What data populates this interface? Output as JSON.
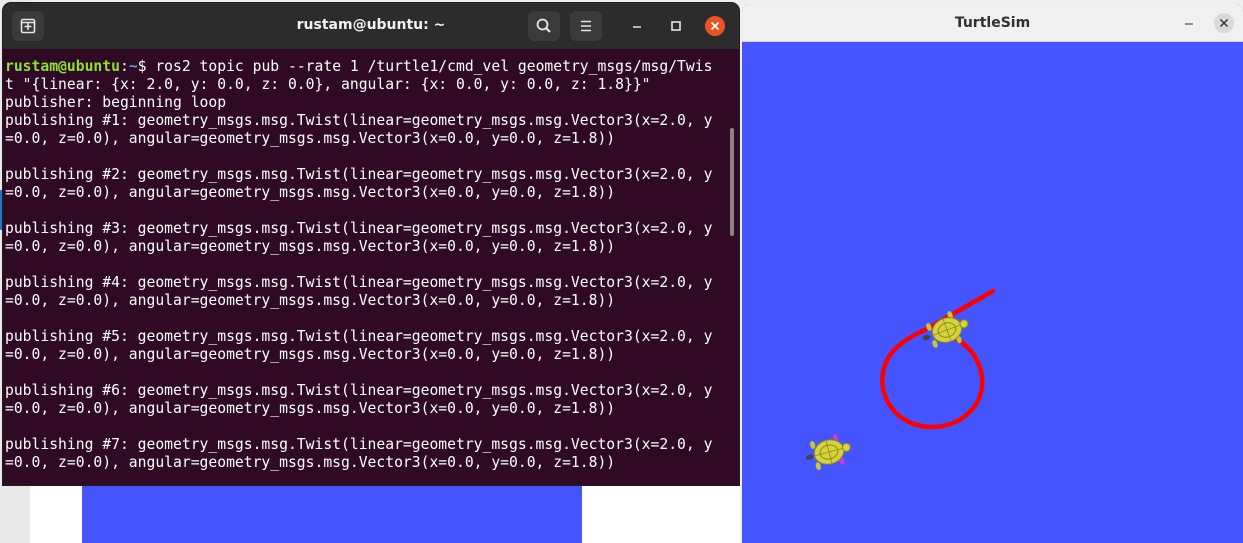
{
  "terminal": {
    "title": "rustam@ubuntu: ~",
    "prompt_user": "rustam@ubuntu",
    "prompt_sep": ":",
    "prompt_path": "~",
    "prompt_symbol": "$ ",
    "lines": [
      "ros2 topic pub --rate 1 /turtle1/cmd_vel geometry_msgs/msg/Twis",
      "t \"{linear: {x: 2.0, y: 0.0, z: 0.0}, angular: {x: 0.0, y: 0.0, z: 1.8}}\"",
      "publisher: beginning loop",
      "publishing #1: geometry_msgs.msg.Twist(linear=geometry_msgs.msg.Vector3(x=2.0, y",
      "=0.0, z=0.0), angular=geometry_msgs.msg.Vector3(x=0.0, y=0.0, z=1.8))",
      "",
      "publishing #2: geometry_msgs.msg.Twist(linear=geometry_msgs.msg.Vector3(x=2.0, y",
      "=0.0, z=0.0), angular=geometry_msgs.msg.Vector3(x=0.0, y=0.0, z=1.8))",
      "",
      "publishing #3: geometry_msgs.msg.Twist(linear=geometry_msgs.msg.Vector3(x=2.0, y",
      "=0.0, z=0.0), angular=geometry_msgs.msg.Vector3(x=0.0, y=0.0, z=1.8))",
      "",
      "publishing #4: geometry_msgs.msg.Twist(linear=geometry_msgs.msg.Vector3(x=2.0, y",
      "=0.0, z=0.0), angular=geometry_msgs.msg.Vector3(x=0.0, y=0.0, z=1.8))",
      "",
      "publishing #5: geometry_msgs.msg.Twist(linear=geometry_msgs.msg.Vector3(x=2.0, y",
      "=0.0, z=0.0), angular=geometry_msgs.msg.Vector3(x=0.0, y=0.0, z=1.8))",
      "",
      "publishing #6: geometry_msgs.msg.Twist(linear=geometry_msgs.msg.Vector3(x=2.0, y",
      "=0.0, z=0.0), angular=geometry_msgs.msg.Vector3(x=0.0, y=0.0, z=1.8))",
      "",
      "publishing #7: geometry_msgs.msg.Twist(linear=geometry_msgs.msg.Vector3(x=2.0, y",
      "=0.0, z=0.0), angular=geometry_msgs.msg.Vector3(x=0.0, y=0.0, z=1.8))"
    ],
    "colors": {
      "background": "#300a24",
      "user": "#8ae234",
      "path": "#729fcf",
      "text": "#ffffff"
    }
  },
  "turtlesim": {
    "title": "TurtleSim",
    "colors": {
      "background": "#4455ff",
      "pen": "#ff0000",
      "turtle_shell": "#d6d33a"
    }
  },
  "icons": [
    "new-tab-icon",
    "search-icon",
    "hamburger-menu-icon",
    "minimize-icon",
    "maximize-icon",
    "close-icon",
    "turtle-icon"
  ]
}
